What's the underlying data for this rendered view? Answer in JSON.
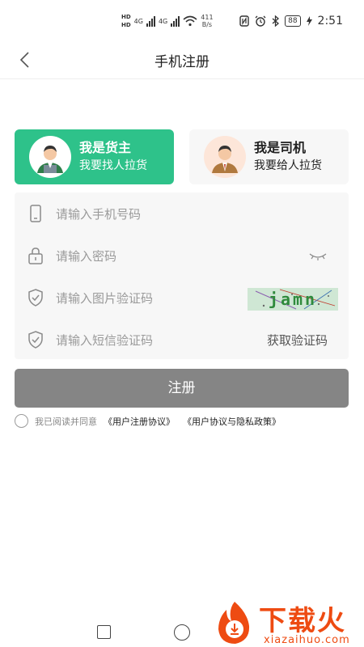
{
  "status_bar": {
    "hd_top": "HD",
    "hd_bottom": "HD",
    "net_type_1": "4G",
    "net_type_2": "4G",
    "net_speed_value": "411",
    "net_speed_unit": "B/s",
    "battery": "88",
    "time": "2:51"
  },
  "header": {
    "title": "手机注册"
  },
  "roles": {
    "shipper": {
      "title": "我是货主",
      "subtitle": "我要找人拉货"
    },
    "driver": {
      "title": "我是司机",
      "subtitle": "我要给人拉货"
    }
  },
  "form": {
    "phone_placeholder": "请输入手机号码",
    "password_placeholder": "请输入密码",
    "image_code_placeholder": "请输入图片验证码",
    "captcha_text": "jamn",
    "sms_code_placeholder": "请输入短信验证码",
    "get_code_label": "获取验证码"
  },
  "register": {
    "label": "注册"
  },
  "agreement": {
    "prefix": "我已阅读并同意",
    "link1": "《用户注册协议》",
    "link2": "《用户协议与隐私政策》"
  },
  "watermark": {
    "text": "下载火",
    "url": "xiazaihuo.com"
  },
  "colors": {
    "accent_green": "#2ec28a",
    "register_button": "#858585",
    "watermark": "#ee4b12"
  }
}
